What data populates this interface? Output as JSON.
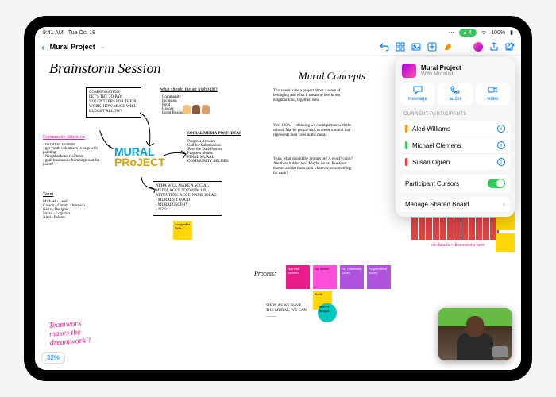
{
  "statusbar": {
    "time": "9:41 AM",
    "date": "Tue Oct 18",
    "battery": "100%",
    "pill_text": "4"
  },
  "toolbar": {
    "back": "‹",
    "title": "Mural Project",
    "chev": "⌄"
  },
  "canvas": {
    "title": "Brainstorm Session",
    "concepts_title": "Mural Concepts",
    "compensation_h": "COMPENSATION",
    "compensation_body": "LET'S TRY TO PAY VOLUNTEERS FOR THEIR WORK. HOW MUCH WILL BUDGET ALLOW?",
    "highlight_h": "what should the art highlight?",
    "highlight_body": "Community\nInclusion\nFood\nHistory\nLocal Businesses",
    "social_h": "SOCIAL MEDIA POST IDEAS",
    "social_body": "Progress Artwork\nCall for Submissions\nSave the Date Posters\nProgress photos\nFINAL MURAL\nCOMMUNITY SELFIES",
    "attention_h": "Community Attention",
    "attention_body": "- recruit art students\n- get youth volunteers to help with painting\n- Neighborhood residents\n- grab businesses from highroad for paints!",
    "team_h": "Team",
    "team_body": "Michael - Lead\nCarson - Comm. Outreach\nNeha - Designer\nSusan - Logistics\nAled - Painter",
    "neha_box": "NEHA WILL MAKE A SOCIAL MEDIA ACCT. TO DRUM UP ATTENTION. ACCT. NAME IDEAS:\n- MURALS 4 GOOD\n- MURALOSOPHY\n- ?????",
    "mural_l1": "MURAL",
    "mural_l2": "PRoJECT",
    "teamwork": "Teamwork\nmakes the\ndreamwork!!",
    "sticky_assigned": "Assigned to Neha",
    "concepts_para": "This needs to be a project about a sense of belonging and what it means to live in our neighborhood, together, now.",
    "concepts_para2": "Yes! 100% — thinking we could partner with the school. Maybe get the kids to create a mural that represents their lives in the mural.",
    "concepts_para3": "Yeah, what should the prompt be? A word? color? Are there kiddos too? Maybe we set five-four themes and let them pick whatever, or something for each?",
    "details_label": "ok details / dimensions here",
    "process_label": "Process:",
    "soon_label": "SOON AS WE HAVE THE MURAL, WE CAN _____",
    "stickies": {
      "p1": "Plan with Teachers",
      "p2": "Get Advice",
      "p3": "Get Community Theme",
      "p4": "Neighborhood Survey",
      "p5": "Booth",
      "p6": "here's a thought"
    }
  },
  "share": {
    "title": "Mural Project",
    "subtitle": "With Muralist",
    "actions": {
      "message": "message",
      "audio": "audio",
      "video": "video"
    },
    "section": "CURRENT PARTICIPANTS",
    "participants": [
      {
        "name": "Aled Williams",
        "color": "#ff9500"
      },
      {
        "name": "Michael Clemens",
        "color": "#34c759"
      },
      {
        "name": "Susan Ogren",
        "color": "#ff3b30"
      }
    ],
    "cursors": "Participant Cursors",
    "manage": "Manage Shared Board"
  },
  "zoom": "32%"
}
